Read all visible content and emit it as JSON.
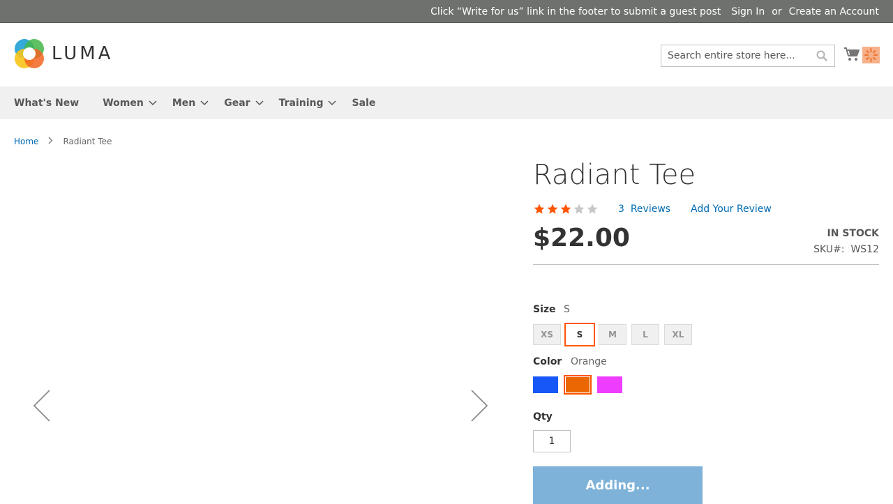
{
  "topbar": {
    "message": "Click “Write for us” link in the footer to submit a guest post",
    "signin": "Sign In",
    "or": "or",
    "create_account": "Create an Account"
  },
  "header": {
    "logo_text": "LUMA",
    "search_placeholder": "Search entire store here...",
    "icons": [
      "search-icon",
      "cart-icon",
      "loading-spinner-icon"
    ]
  },
  "nav": {
    "items": [
      "What's New",
      "Women",
      "Men",
      "Gear",
      "Training",
      "Sale"
    ]
  },
  "breadcrumb": {
    "home": "Home",
    "current": "Radiant Tee"
  },
  "product": {
    "title": "Radiant Tee",
    "rating": 3,
    "rating_max": 5,
    "reviews_count": "3",
    "reviews_label": "Reviews",
    "add_review": "Add Your Review",
    "price": "$22.00",
    "stock": "In stock",
    "sku_label": "SKU#:",
    "sku": "WS12",
    "size_label": "Size",
    "size_selected": "S",
    "sizes": [
      "XS",
      "S",
      "M",
      "L",
      "XL"
    ],
    "color_label": "Color",
    "color_selected": "Orange",
    "colors": [
      {
        "name": "Blue",
        "hex": "#1857f7"
      },
      {
        "name": "Orange",
        "hex": "#eb6703"
      },
      {
        "name": "Purple",
        "hex": "#ef3dff"
      }
    ],
    "qty_label": "Qty",
    "qty": "1",
    "add_button": "Adding..."
  },
  "colors": {
    "topbar_bg": "#6e716e",
    "nav_bg": "#f0f0f0",
    "link": "#006bb4",
    "star_on": "#ff5501",
    "star_off": "#c7c7c7",
    "accent": "#ff5501",
    "add_button_bg": "#7eb2d9"
  }
}
